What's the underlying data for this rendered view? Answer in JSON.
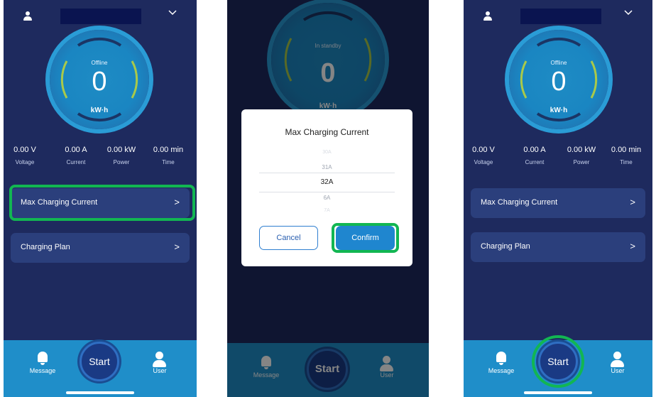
{
  "screens": [
    {
      "gauge": {
        "status": "Offline",
        "value": "0",
        "unit": "kW·h"
      },
      "stats": [
        {
          "value": "0.00 V",
          "label": "Voltage"
        },
        {
          "value": "0.00 A",
          "label": "Current"
        },
        {
          "value": "0.00 kW",
          "label": "Power"
        },
        {
          "value": "0.00 min",
          "label": "Time"
        }
      ],
      "rows": [
        {
          "label": "Max Charging Current",
          "arrow": ">"
        },
        {
          "label": "Charging Plan",
          "arrow": ">"
        }
      ],
      "tabbar": {
        "message": "Message",
        "start": "Start",
        "user": "User"
      }
    },
    {
      "gauge": {
        "status": "In standby",
        "value": "0",
        "unit": "kW·h"
      },
      "dialog": {
        "title": "Max Charging Current",
        "options": [
          "30A",
          "31A",
          "32A",
          "6A",
          "7A"
        ],
        "selected": "32A",
        "cancel": "Cancel",
        "confirm": "Confirm"
      },
      "tabbar": {
        "message": "Message",
        "start": "Start",
        "user": "User"
      }
    },
    {
      "gauge": {
        "status": "Offline",
        "value": "0",
        "unit": "kW·h"
      },
      "stats": [
        {
          "value": "0.00 V",
          "label": "Voltage"
        },
        {
          "value": "0.00 A",
          "label": "Current"
        },
        {
          "value": "0.00 kW",
          "label": "Power"
        },
        {
          "value": "0.00 min",
          "label": "Time"
        }
      ],
      "rows": [
        {
          "label": "Max Charging Current",
          "arrow": ">"
        },
        {
          "label": "Charging Plan",
          "arrow": ">"
        }
      ],
      "tabbar": {
        "message": "Message",
        "start": "Start",
        "user": "User"
      }
    }
  ],
  "colors": {
    "background": "#1e2a5e",
    "tabbar": "#1f8ec9",
    "highlight": "#12b652",
    "row": "#2b3f7c"
  },
  "icons": [
    "user-icon",
    "chevron-down-icon",
    "bell-icon",
    "chevron-right-icon"
  ]
}
